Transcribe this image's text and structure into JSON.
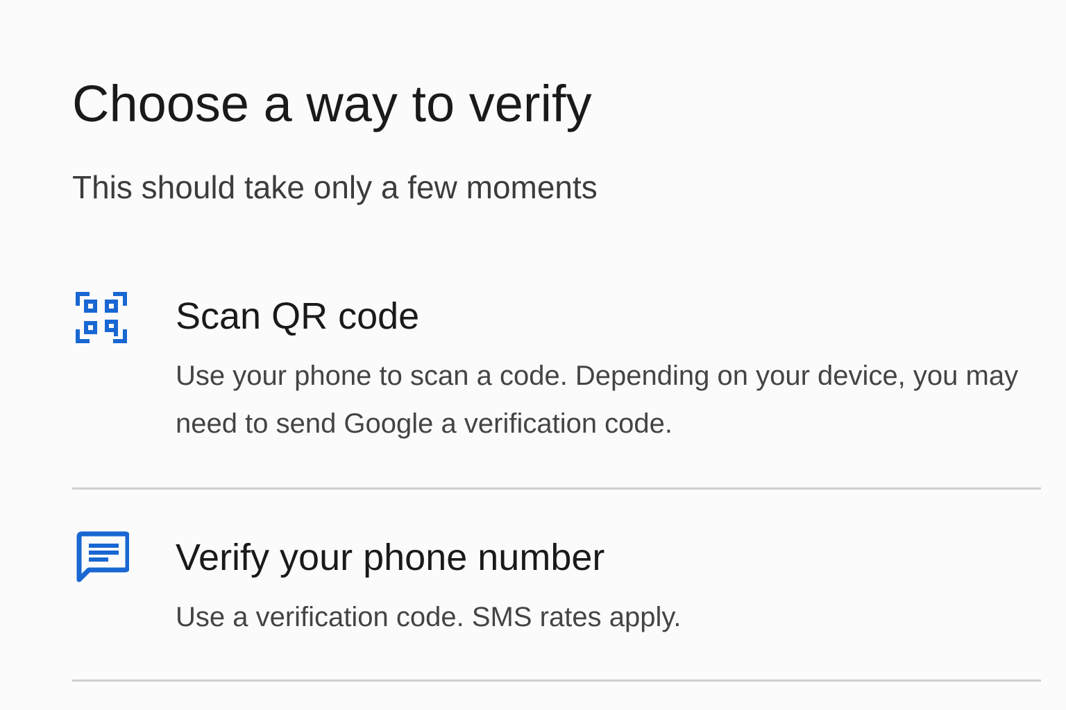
{
  "header": {
    "title": "Choose a way to verify",
    "subtitle": "This should take only a few moments"
  },
  "options": [
    {
      "icon": "qr-code-scan-icon",
      "title": "Scan QR code",
      "description": "Use your phone to scan a code. Depending on your device, you may need to send Google a verification code."
    },
    {
      "icon": "sms-message-icon",
      "title": "Verify your phone number",
      "description": "Use a verification code. SMS rates apply."
    }
  ],
  "colors": {
    "accent": "#1967d2",
    "divider": "#cfcfcf",
    "background": "#fbfbfb"
  }
}
